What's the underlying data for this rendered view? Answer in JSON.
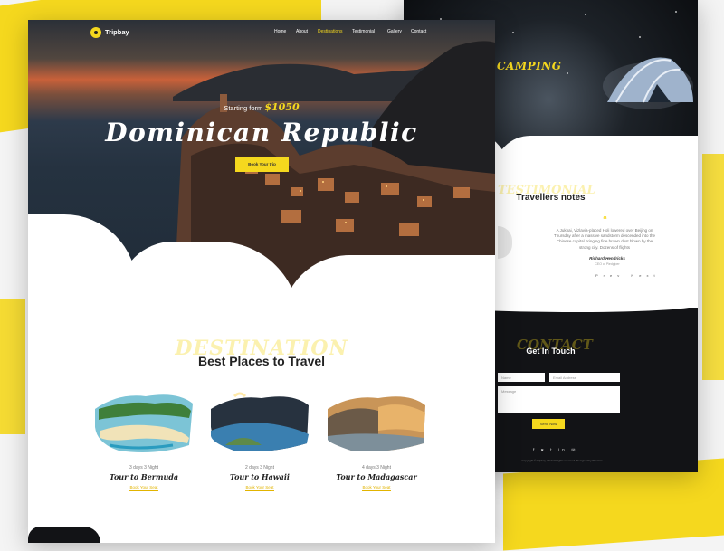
{
  "brand": {
    "name": "Tripbay"
  },
  "nav": {
    "items": [
      {
        "label": "Home",
        "active": false
      },
      {
        "label": "About",
        "active": false
      },
      {
        "label": "Destinations",
        "active": true
      },
      {
        "label": "Testimonial",
        "active": false
      },
      {
        "label": "Gallery",
        "active": false
      },
      {
        "label": "Contact",
        "active": false
      }
    ]
  },
  "hero": {
    "starting_label": "Starting form",
    "price": "$1050",
    "title": "Dominican Republic",
    "cta": "Book Your trip"
  },
  "destinations": {
    "ghost_text": "DESTINATION",
    "title": "Best Places to Travel",
    "cards": [
      {
        "duration": "3 days 3 Night",
        "title": "Tour to Bermuda",
        "link": "Book Your Seat"
      },
      {
        "duration": "2 days 3 Night",
        "title": "Tour to Hawaii",
        "link": "Book Your Seat"
      },
      {
        "duration": "4 days 3 Night",
        "title": "Tour to Madagascar",
        "link": "Book Your Seat"
      }
    ]
  },
  "camping": {
    "title": "CAMPING"
  },
  "testimonial": {
    "ghost_text": "TESTIMONIAL",
    "title": "Travellers notes",
    "quote_mark": "“",
    "quote": "A Jukhai, Vizlavia-placed Holi lowered over Beijing on Thursday after a massive sandstorm descended into the Chinese capital bringing fine brown dust blown by the strong city. Dozens of flights",
    "name": "Richard Hendricks",
    "role": "CEO of Piedpiper",
    "nav": [
      "Prev",
      "Next"
    ]
  },
  "contact": {
    "ghost_text": "CONTACT",
    "title": "Get In Touch",
    "name_placeholder": "Name",
    "email_placeholder": "Email Address",
    "message_placeholder": "Message",
    "send": "Send Now",
    "socials": [
      "f",
      "♥",
      "t",
      "in",
      "✉"
    ],
    "copyright": "Copyright © Tripbay 2017 All rights reserved. Designed by Sharmin"
  },
  "colors": {
    "accent": "#f5d81e",
    "dark": "#121316",
    "text": "#222222"
  }
}
